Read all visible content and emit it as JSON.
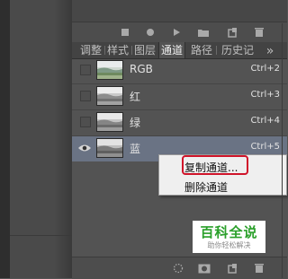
{
  "tabs": [
    {
      "label": "调整",
      "active": false
    },
    {
      "label": "样式",
      "active": false
    },
    {
      "label": "图层",
      "active": false
    },
    {
      "label": "通道",
      "active": true
    },
    {
      "label": "路径",
      "active": false
    },
    {
      "label": "历史记",
      "active": false
    }
  ],
  "channels": [
    {
      "name": "RGB",
      "shortcut": "Ctrl+2",
      "visible": false,
      "selected": false
    },
    {
      "name": "红",
      "shortcut": "Ctrl+3",
      "visible": false,
      "selected": false
    },
    {
      "name": "绿",
      "shortcut": "Ctrl+4",
      "visible": false,
      "selected": false
    },
    {
      "name": "蓝",
      "shortcut": "Ctrl+5",
      "visible": true,
      "selected": true
    }
  ],
  "context_menu": {
    "items": [
      {
        "label": "复制通道..."
      },
      {
        "label": "删除通道"
      }
    ]
  },
  "watermark": {
    "title": "百科全说",
    "subtitle": "助你轻松解决"
  },
  "colors": {
    "selected_row": "#6a7384",
    "highlight": "#d0142a",
    "watermark_green": "#2aa02a"
  },
  "toolbar_top_icons": [
    "square-icon",
    "circle-icon",
    "play-icon",
    "folder-icon",
    "new-layer-icon",
    "trash-icon"
  ],
  "toolbar_bottom_icons": [
    "dotted-circle-icon",
    "mask-icon",
    "new-channel-icon",
    "trash-icon"
  ]
}
